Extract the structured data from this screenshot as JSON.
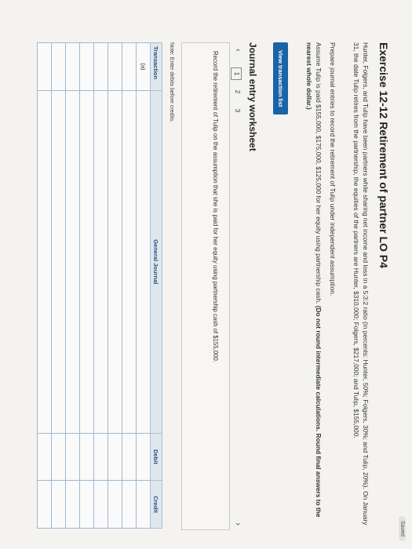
{
  "status": {
    "saved": "Saved"
  },
  "exercise": {
    "title": "Exercise 12-12 Retirement of partner LO P4",
    "paragraph1": "Hunter, Folgers, and Tulip have been partners while sharing net income and loss in a 5:3:2 ratio (in percents: Hunter, 50%; Folgers, 30%; and Tulip, 20%). On January 31, the date Tulip retires from the partnership, the equities of the partners are Hunter, $310,000; Folgers, $217,000; and Tulip, $155,000.",
    "paragraph2": "Prepare journal entries to record the retirement of Tulip under independent assumption.",
    "paragraph3": "Assume Tulip is paid $155,000, $175,000, $125,000 for her equity using partnership cash.",
    "paragraph3_bold": "(Do not round intermediate calculations. Round final answers to the nearest whole dollar.)"
  },
  "view_button": "View transaction list",
  "worksheet": {
    "title": "Journal entry worksheet",
    "steps": [
      "1",
      "2",
      "3"
    ],
    "prev_icon": "chevron-left-icon",
    "next_icon": "chevron-right-icon",
    "instruction": "Record the retirement of Tulip on the assumption that she is paid for her equity using partnership cash of $155,000.",
    "note": "Note: Enter debits before credits."
  },
  "table": {
    "headers": [
      "Transaction",
      "General Journal",
      "Debit",
      "Credit"
    ],
    "rows": [
      [
        "(a)",
        "",
        "",
        ""
      ],
      [
        "",
        "",
        "",
        ""
      ],
      [
        "",
        "",
        "",
        ""
      ],
      [
        "",
        "",
        "",
        ""
      ],
      [
        "",
        "",
        "",
        ""
      ],
      [
        "",
        "",
        "",
        ""
      ],
      [
        "",
        "",
        "",
        ""
      ],
      [
        "",
        "",
        "",
        ""
      ]
    ]
  }
}
